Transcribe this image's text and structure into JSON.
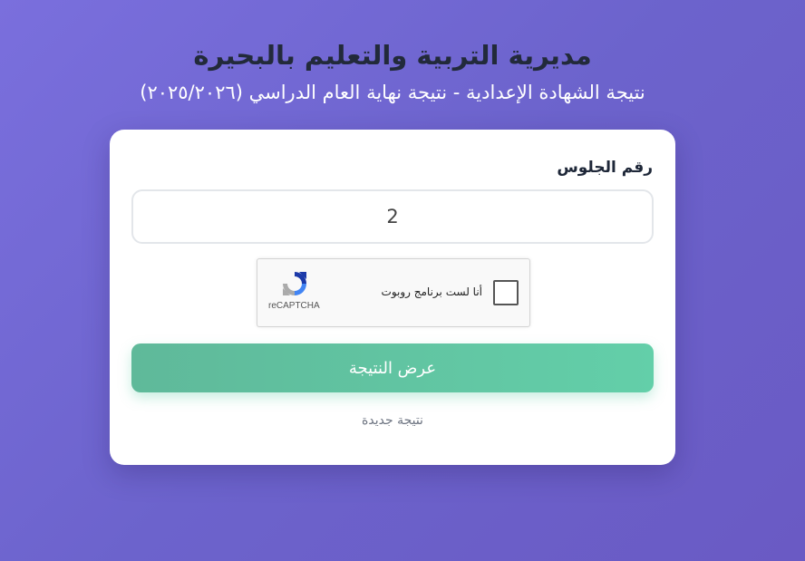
{
  "header": {
    "title": "مديرية التربية والتعليم بالبحيرة",
    "subtitle": "نتيجة الشهادة الإعدادية - نتيجة نهاية العام الدراسي (٢٠٢٥/٢٠٢٦)"
  },
  "form": {
    "seat_label": "رقم الجلوس",
    "seat_value": "2",
    "recaptcha": {
      "label": "أنا لست برنامج روبوت",
      "brand": "reCAPTCHA"
    },
    "submit_label": "عرض النتيجة",
    "new_result_label": "نتيجة جديدة"
  },
  "colors": {
    "accent_green": "#63cfa9",
    "title_dark": "#222a3a",
    "background": "#6c63cc"
  }
}
